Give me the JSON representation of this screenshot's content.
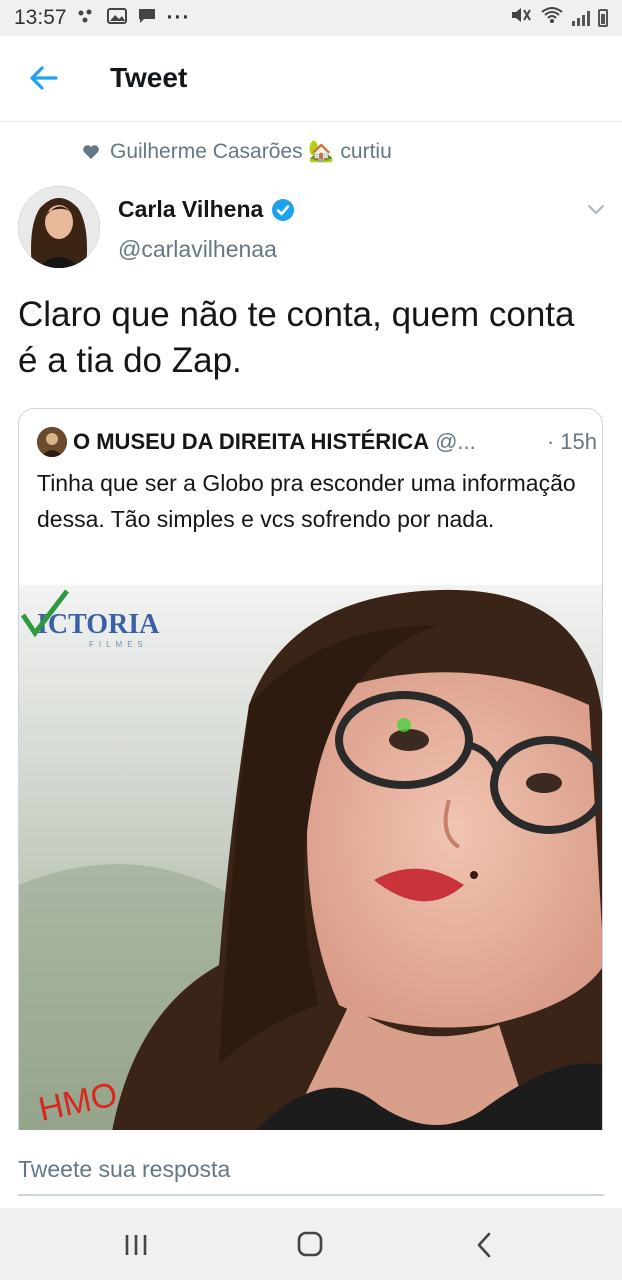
{
  "status_bar": {
    "time": "13:57",
    "dots": "···"
  },
  "header": {
    "title": "Tweet",
    "back_icon": "arrow-left-icon",
    "accent_color": "#1da1f2"
  },
  "liked_by": {
    "text": "Guilherme Casarões 🏡 curtiu"
  },
  "tweet": {
    "author_name": "Carla Vilhena",
    "author_handle": "@carlavilhenaa",
    "verified_icon": "verified-badge-icon",
    "text": "Claro que não te conta, quem conta é a tia do Zap."
  },
  "quoted_tweet": {
    "author_name": "O MUSEU DA DIREITA HISTÉRICA",
    "author_handle": "@...",
    "time": "· 15h",
    "text": "Tinha que ser a Globo pra esconder uma informação dessa. Tão simples e vcs sofrendo por nada.",
    "media": {
      "watermark": "ICTORIA",
      "watermark_sub": "FILMES",
      "corner_tag": "HMO"
    }
  },
  "reply": {
    "placeholder": "Tweete sua resposta"
  },
  "nav": {
    "recents_icon": "recent-apps-icon",
    "home_icon": "home-icon",
    "back_icon": "back-icon"
  }
}
